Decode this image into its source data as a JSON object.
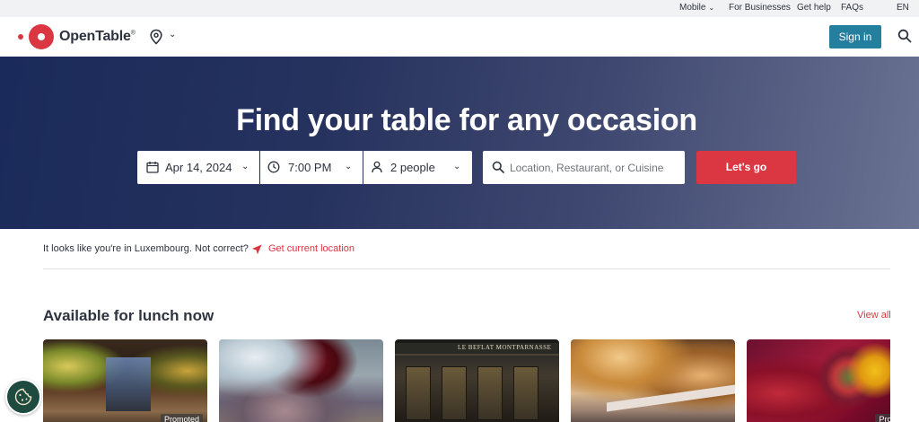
{
  "utility": {
    "mobile_label": "Mobile",
    "for_businesses": "For Businesses",
    "get_help": "Get help",
    "faqs": "FAQs",
    "language": "EN"
  },
  "header": {
    "brand": "OpenTable",
    "brand_mark": "®",
    "sign_in": "Sign in"
  },
  "hero": {
    "title": "Find your table for any occasion",
    "date_value": "Apr 14, 2024",
    "time_value": "7:00 PM",
    "party_value": "2 people",
    "search_placeholder": "Location, Restaurant, or Cuisine",
    "submit_label": "Let's go"
  },
  "location_notice": {
    "text": "It looks like you're in Luxembourg. Not correct?",
    "action": "Get current location"
  },
  "section": {
    "title": "Available for lunch now",
    "view_all": "View all",
    "cards": [
      {
        "badge": "Promoted"
      },
      {
        "badge": ""
      },
      {
        "badge": "",
        "sign": "LE BEFLAT MONTPARNASSE"
      },
      {
        "badge": ""
      },
      {
        "badge": "Promo"
      }
    ]
  },
  "colors": {
    "brand_red": "#da3743",
    "sign_in_teal": "#247f9e",
    "hero_navy": "#1a2a5a",
    "cookie_green": "#1e4a40"
  },
  "icons": {
    "logo": "opentable-logo-icon",
    "location": "location-pin-icon",
    "search": "search-icon",
    "calendar": "calendar-icon",
    "clock": "clock-icon",
    "person": "person-icon",
    "navigation": "navigation-arrow-icon",
    "cookie": "cookie-icon"
  }
}
